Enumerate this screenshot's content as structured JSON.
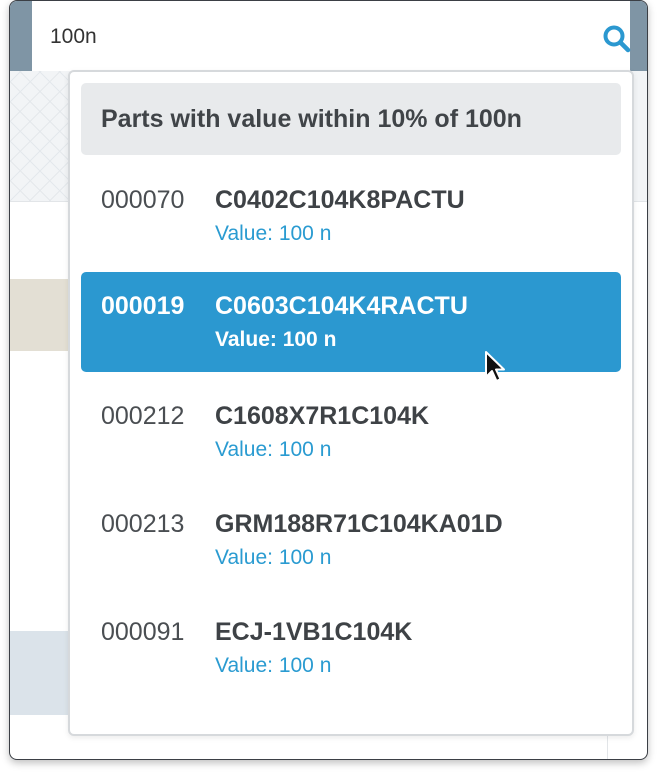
{
  "search": {
    "value": "100n",
    "icon": "search-icon",
    "accent_color": "#2b98d0"
  },
  "dropdown": {
    "header": "Parts with value within 10% of 100n",
    "selected_index": 1,
    "results": [
      {
        "id": "000070",
        "part": "C0402C104K8PACTU",
        "value": "Value: 100 n"
      },
      {
        "id": "000019",
        "part": "C0603C104K4RACTU",
        "value": "Value: 100 n"
      },
      {
        "id": "000212",
        "part": "C1608X7R1C104K",
        "value": "Value: 100 n"
      },
      {
        "id": "000213",
        "part": "GRM188R71C104KA01D",
        "value": "Value: 100 n"
      },
      {
        "id": "000091",
        "part": "ECJ-1VB1C104K",
        "value": "Value: 100 n"
      }
    ]
  },
  "colors": {
    "selected_row": "#2b98d0",
    "value_text": "#2a9bd1",
    "header_bg": "#e8eaec"
  },
  "cursor_icon": "mouse-pointer-icon"
}
